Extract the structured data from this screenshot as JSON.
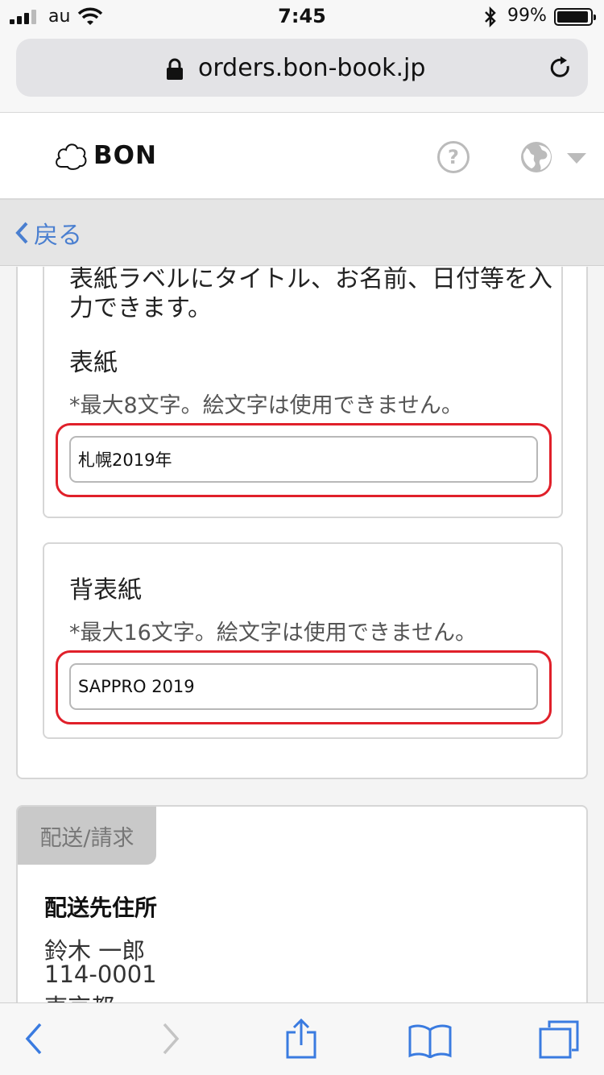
{
  "status_bar": {
    "carrier": "au",
    "time": "7:45",
    "battery": "99%"
  },
  "browser": {
    "url": "orders.bon-book.jp"
  },
  "header": {
    "logo_text": "BON",
    "help_glyph": "?"
  },
  "nav": {
    "back_label": "戻る"
  },
  "cover_section": {
    "intro": "表紙ラベルにタイトル、お名前、日付等を入力できます。",
    "front": {
      "label": "表紙",
      "note": "*最大8文字。絵文字は使用できません。",
      "value": "札幌2019年"
    },
    "spine": {
      "label": "背表紙",
      "note": "*最大16文字。絵文字は使用できません。",
      "value": "SAPPRO 2019"
    }
  },
  "shipping_section": {
    "tab": "配送/請求",
    "address_title": "配送先住所",
    "address_lines": [
      "鈴木 一郎",
      "114-0001",
      "東京都"
    ]
  },
  "colors": {
    "accent": "#4a7fd0",
    "highlight": "#e0202a"
  }
}
